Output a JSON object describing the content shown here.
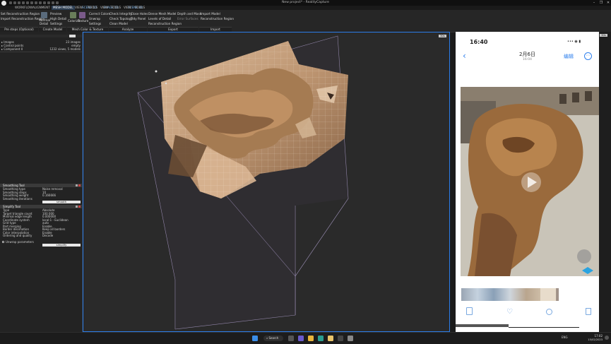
{
  "window": {
    "title": "New project* - RealityCapture",
    "controls": [
      "–",
      "❐",
      "✕"
    ]
  },
  "tabs": {
    "items": [
      {
        "label": "WORKFLOW"
      },
      {
        "label": "ALIGNMENT"
      },
      {
        "label": "MESH MODEL"
      },
      {
        "label": "VIEW"
      },
      {
        "label": "TOOLS"
      },
      {
        "label": "VIEW"
      },
      {
        "label": "TOOLS"
      },
      {
        "label": "VIEW"
      },
      {
        "label": "TOOLS"
      }
    ],
    "contexts": [
      "SCENE 1D",
      "IMAGE 1D",
      "SCENE 3D"
    ]
  },
  "ribbon": {
    "reconstruction": {
      "set_region": "Set Reconstruction Region",
      "import_region": "Import Reconstruction Region",
      "group": "Pre steps (Optional)"
    },
    "create_model": {
      "normal_detail": "Normal Detail",
      "preview": "Preview",
      "high_detail": "High Detail",
      "settings": "Settings",
      "group": "Create Model"
    },
    "color": {
      "colorize": "Colorize",
      "texture": "Texture",
      "correct_colors": "Correct Colors",
      "unwrap": "Unwrap",
      "settings": "Settings",
      "group": "Mesh Color & Texture"
    },
    "analyze": {
      "check_integrity": "Check Integrity",
      "check_topology": "Check Topology",
      "clean_model": "Clean Model",
      "close_holes": "Close Holes",
      "tidy_panel": "Tidy Panel",
      "group": "Analyze"
    },
    "export": {
      "dense_mesh_model": "Dense Mesh Model",
      "levels_of_detail": "Levels of Detail",
      "reconstruction_region": "Reconstruction Region",
      "depth_and_mask": "Depth and Mask",
      "error_surfaces": "Error Surfaces",
      "group": "Export"
    },
    "import": {
      "import_model": "Import Model",
      "reconstruction_region": "Reconstruction Region",
      "group": "Import"
    }
  },
  "left_panel": {
    "tree": [
      {
        "label": "Images",
        "value": "23 images"
      },
      {
        "label": "Control points",
        "value": "empty"
      },
      {
        "label": "Component 0",
        "value": "1232 views, 5 models"
      }
    ],
    "smoothing_tool": {
      "title": "Smoothing Tool",
      "rows": [
        {
          "label": "Smoothing type",
          "value": "Noise removal"
        },
        {
          "label": "Smoothing steps",
          "value": "10"
        },
        {
          "label": "Smoothing weight",
          "value": "0.166666"
        },
        {
          "label": "Smoothing iterations",
          "value": ""
        }
      ],
      "action": "smooth"
    },
    "simplify_tool": {
      "title": "Simplify Tool",
      "rows": [
        {
          "label": "Type",
          "value": "Absolute"
        },
        {
          "label": "Target triangle count",
          "value": "100 000"
        },
        {
          "label": "Minimal edge length",
          "value": "0.000000"
        },
        {
          "label": "Coordinate system",
          "value": "local:1 - Euclidean"
        },
        {
          "label": "Grid type",
          "value": "auto"
        },
        {
          "label": "Part merging",
          "value": "Enable"
        },
        {
          "label": "Border decimation",
          "value": "Keep all borders"
        },
        {
          "label": "Color interpolation",
          "value": "Enable"
        },
        {
          "label": "Ordering and quality",
          "value": "Decode"
        }
      ],
      "checkbox": "Unwrap parameters",
      "action": "simplify"
    }
  },
  "viewport": {
    "label": "3Ds"
  },
  "phone": {
    "time": "16:40",
    "date_title": "2月6日",
    "date_subtitle": "16:04",
    "edit_label": "编辑",
    "status_icons": "•••  ◉  ▮",
    "back_icon": "‹",
    "more_icon": "⋯"
  },
  "right_strip": {
    "label": "3Ds"
  },
  "taskbar": {
    "search": "Search",
    "time": "17:02",
    "date": "15/02/2023",
    "tray": "ENG"
  },
  "colors": {
    "accent_blue": "#2b7de9",
    "ribbon_bg": "#262626",
    "viewport_bg": "#2a2a2a",
    "mesh_tone": "#c8a27e"
  }
}
